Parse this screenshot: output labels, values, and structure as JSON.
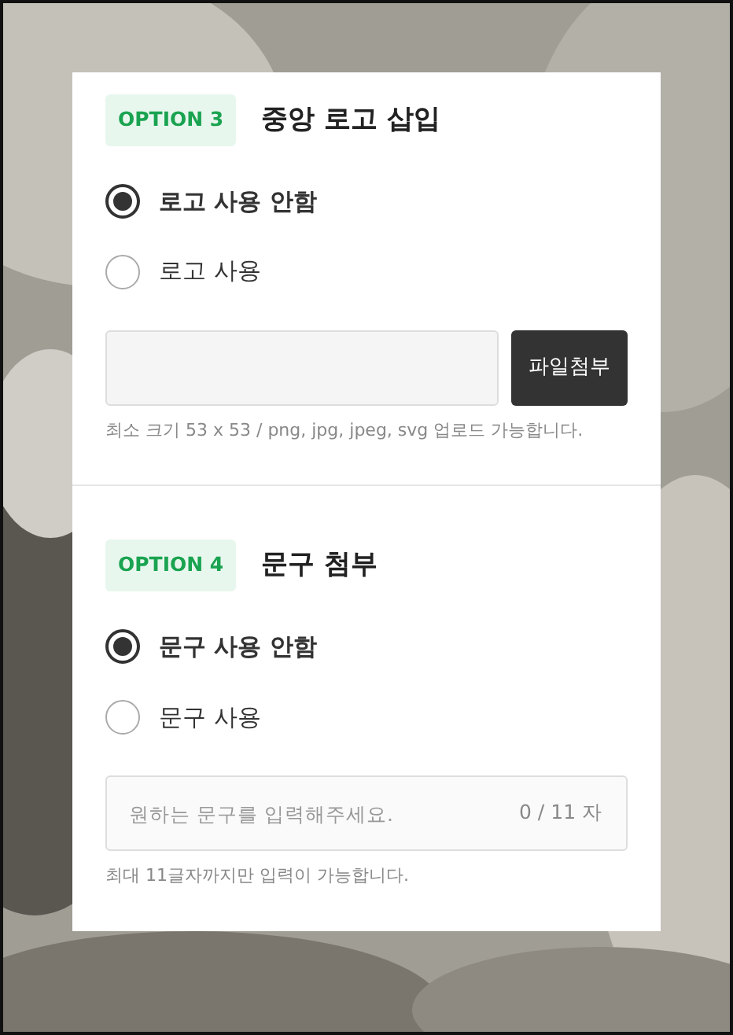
{
  "sections": [
    {
      "badge": "OPTION 3",
      "title": "중앙 로고 삽입",
      "options": [
        {
          "label": "로고 사용 안함",
          "selected": true
        },
        {
          "label": "로고 사용",
          "selected": false
        }
      ],
      "field": {
        "kind": "file",
        "button": "파일첨부"
      },
      "hint": "최소 크기 53 x 53 / png, jpg, jpeg, svg 업로드 가능합니다."
    },
    {
      "badge": "OPTION 4",
      "title": "문구 첨부",
      "options": [
        {
          "label": "문구 사용 안함",
          "selected": true
        },
        {
          "label": "문구 사용",
          "selected": false
        }
      ],
      "field": {
        "kind": "text",
        "placeholder": "원하는 문구를 입력해주세요.",
        "counter": "0 / 11 자"
      },
      "hint": "최대 11글자까지만 입력이 가능합니다."
    }
  ]
}
